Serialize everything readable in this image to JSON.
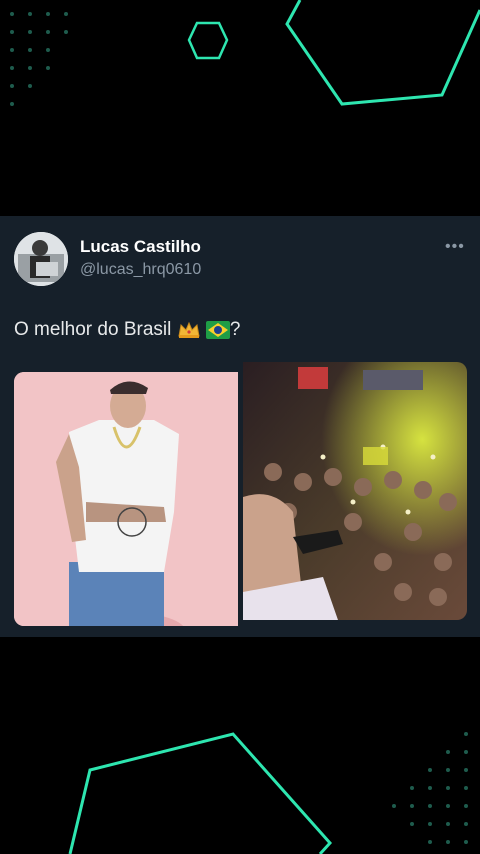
{
  "tweet": {
    "name": "Lucas Castilho",
    "handle": "@lucas_hrq0610",
    "text": "O melhor do Brasil",
    "text_suffix": "?",
    "emojis": [
      "crown-emoji",
      "brazil-flag-emoji"
    ],
    "more_label": "•••"
  },
  "colors": {
    "background": "#000000",
    "card": "#16202a",
    "accent": "#2ee6b0",
    "handle": "#8b98a5"
  }
}
